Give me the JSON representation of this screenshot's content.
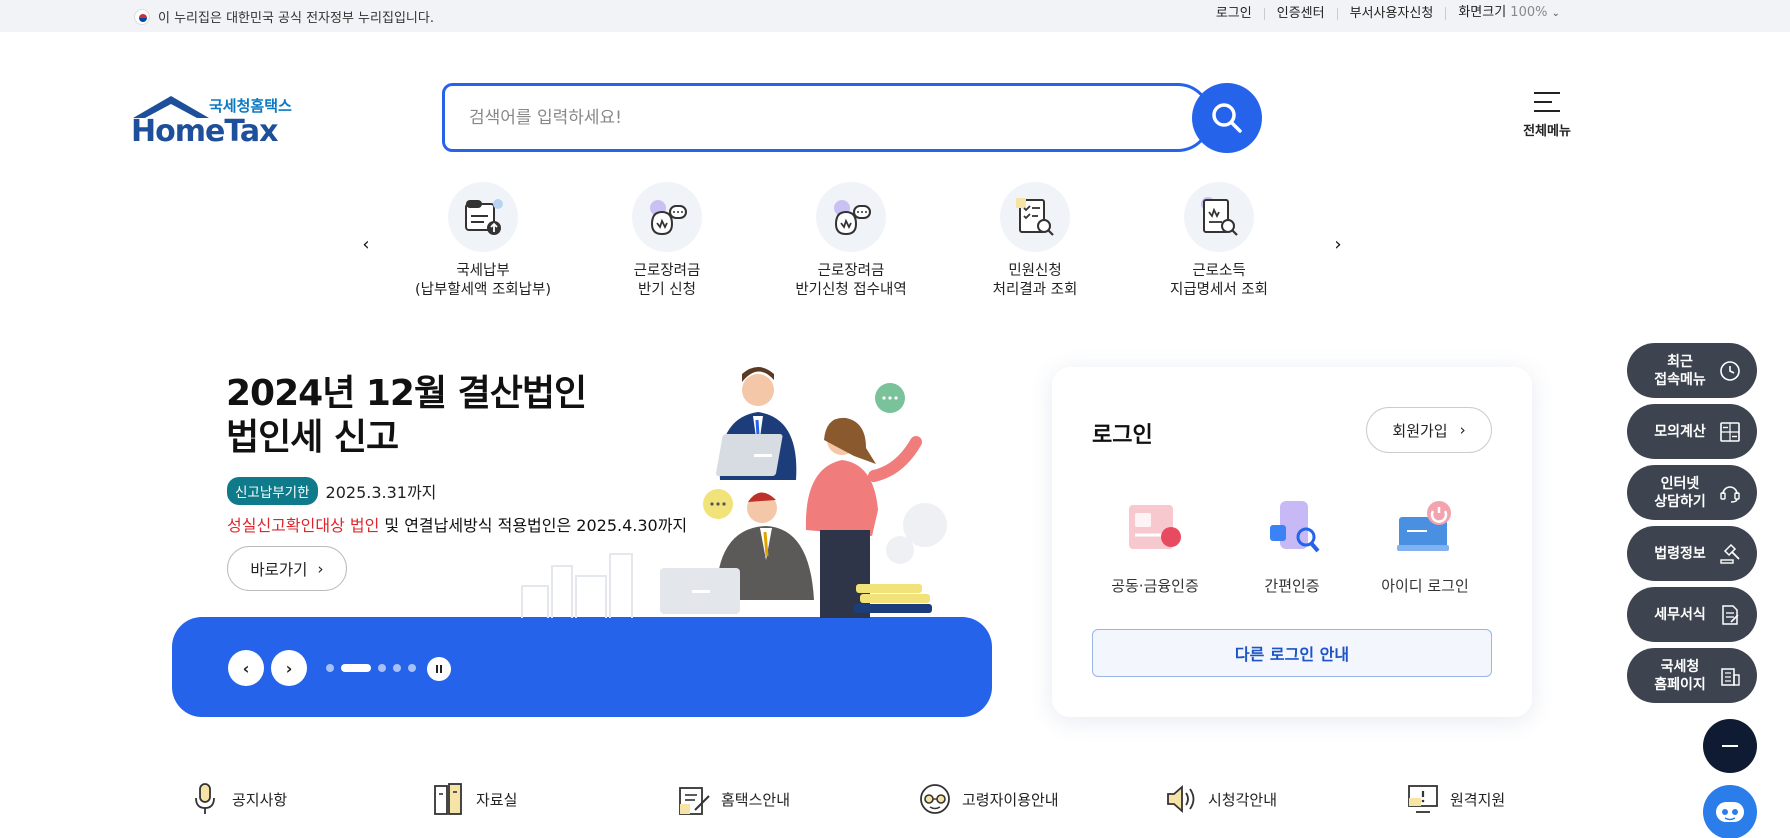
{
  "govbar": {
    "notice": "이 누리집은 대한민국 공식 전자정부 누리집입니다.",
    "links": [
      "로그인",
      "인증센터",
      "부서사용자신청",
      "화면크기"
    ],
    "zoom": "100%"
  },
  "header": {
    "logo_sub": "국세청홈택스",
    "logo_main": "HomeTax",
    "search_placeholder": "검색어를 입력하세요!",
    "all_menu": "전체메뉴"
  },
  "quick_menu": [
    {
      "label": "국세납부\n(납부할세액 조회납부)",
      "icon": "tax-payment-icon"
    },
    {
      "label": "근로장려금\n반기 신청",
      "icon": "incentive-apply-icon"
    },
    {
      "label": "근로장려금\n반기신청 접수내역",
      "icon": "incentive-history-icon"
    },
    {
      "label": "민원신청\n처리결과 조회",
      "icon": "civil-result-icon"
    },
    {
      "label": "근로소득\n지급명세서 조회",
      "icon": "income-statement-icon"
    }
  ],
  "banner": {
    "title": "2024년 12월 결산법인\n법인세 신고",
    "badge": "신고납부기한",
    "deadline": "2025.3.31까지",
    "note_red": "성실신고확인대상 법인",
    "note_rest": " 및 연결납세방식 적용법인은 2025.4.30까지",
    "go": "바로가기"
  },
  "login": {
    "title": "로그인",
    "join": "회원가입",
    "options": [
      "공동·금융인증",
      "간편인증",
      "아이디 로그인"
    ],
    "other": "다른 로그인 안내"
  },
  "side_menu": [
    {
      "label": "최근\n접속메뉴",
      "icon": "clock-icon"
    },
    {
      "label": "모의계산",
      "icon": "calculator-icon"
    },
    {
      "label": "인터넷\n상담하기",
      "icon": "consult-icon"
    },
    {
      "label": "법령정보",
      "icon": "gavel-icon"
    },
    {
      "label": "세무서식",
      "icon": "form-icon"
    },
    {
      "label": "국세청\n홈페이지",
      "icon": "building-icon"
    }
  ],
  "bottom_links": [
    {
      "label": "공지사항",
      "icon": "microphone-icon"
    },
    {
      "label": "자료실",
      "icon": "archive-icon"
    },
    {
      "label": "홈택스안내",
      "icon": "guide-icon"
    },
    {
      "label": "고령자이용안내",
      "icon": "senior-icon"
    },
    {
      "label": "시청각안내",
      "icon": "speaker-icon"
    },
    {
      "label": "원격지원",
      "icon": "remote-support-icon"
    }
  ],
  "colors": {
    "primary": "#2563eb",
    "side": "#3d4450",
    "logo": "#1d4f9a",
    "teal": "#0f7a8a",
    "red": "#e0262d"
  }
}
